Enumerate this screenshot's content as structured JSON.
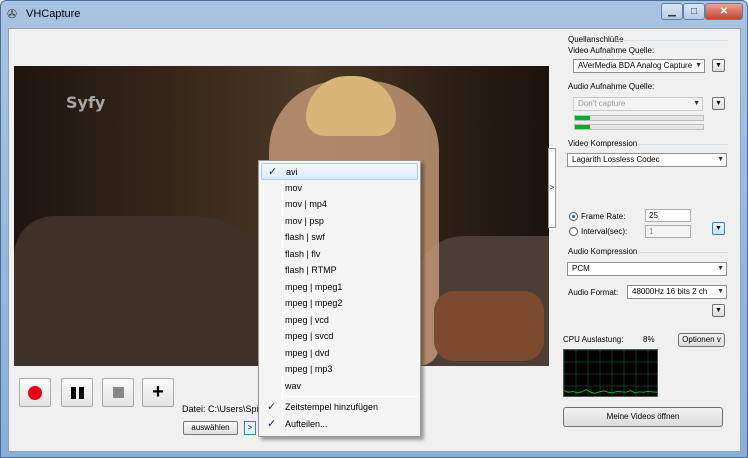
{
  "window": {
    "title": "VHCapture"
  },
  "video": {
    "watermark": "Syfy"
  },
  "controls": {
    "file_label": "Datei: C:\\Users\\Spiel",
    "select_button": "auswählen",
    "more_button": ">",
    "expander": ">",
    "plus": "+"
  },
  "menu": {
    "items": [
      {
        "label": "avi",
        "checked": true,
        "highlighted": true
      },
      {
        "label": "mov",
        "checked": false
      },
      {
        "label": "mov | mp4",
        "checked": false
      },
      {
        "label": "mov | psp",
        "checked": false
      },
      {
        "label": "flash | swf",
        "checked": false
      },
      {
        "label": "flash | flv",
        "checked": false
      },
      {
        "label": "flash | RTMP",
        "checked": false
      },
      {
        "label": "mpeg | mpeg1",
        "checked": false
      },
      {
        "label": "mpeg | mpeg2",
        "checked": false
      },
      {
        "label": "mpeg | vcd",
        "checked": false
      },
      {
        "label": "mpeg | svcd",
        "checked": false
      },
      {
        "label": "mpeg | dvd",
        "checked": false
      },
      {
        "label": "mpeg | mp3",
        "checked": false
      },
      {
        "label": "wav",
        "checked": false
      }
    ],
    "extra_items": [
      {
        "label": "Zeitstempel hinzufügen",
        "checked": true
      },
      {
        "label": "Aufteilen...",
        "checked": true
      }
    ]
  },
  "sources": {
    "title": "Quellanschlüße",
    "video_label": "Video Aufnahme Quelle:",
    "video_value": "AVerMedia BDA Analog Capture",
    "audio_label": "Audio Aufnahme Quelle:",
    "audio_value": "Don't capture",
    "levels": [
      0.12,
      0.12
    ]
  },
  "video_compression": {
    "title": "Video Kompression",
    "codec": "Lagarith Lossless Codec",
    "frame_rate_label": "Frame Rate:",
    "frame_rate_value": "25",
    "interval_label": "Interval(sec):",
    "interval_value": "1"
  },
  "audio_compression": {
    "title": "Audio Kompression",
    "codec": "PCM",
    "format_label": "Audio Format:",
    "format_value": "48000Hz 16 bits 2 ch"
  },
  "cpu": {
    "label": "CPU Auslastung:",
    "value": "8%",
    "options_button": "Optionen v",
    "series": [
      12,
      8,
      10,
      7,
      9,
      14,
      8,
      6,
      9,
      11,
      8,
      7,
      10,
      9,
      8,
      12,
      7,
      9,
      8,
      10,
      9,
      8
    ]
  },
  "open_videos_button": "Meine Videos öffnen",
  "colors": {
    "accent": "#3c7fb1",
    "record": "#e8001a",
    "level": "#06b025",
    "graph_line": "#00c000"
  }
}
